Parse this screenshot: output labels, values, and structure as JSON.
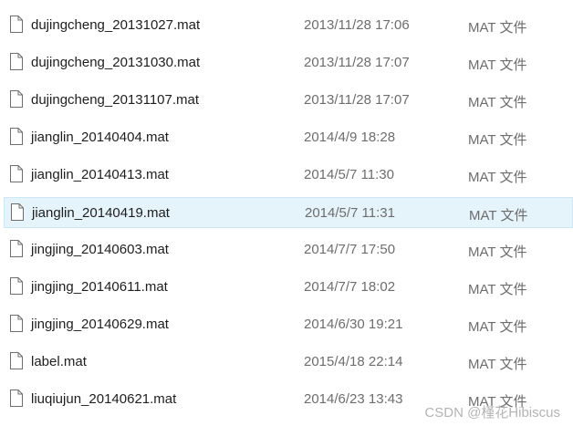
{
  "files": [
    {
      "name": "dujingcheng_20131027.mat",
      "date": "2013/11/28 17:06",
      "type": "MAT 文件",
      "selected": false
    },
    {
      "name": "dujingcheng_20131030.mat",
      "date": "2013/11/28 17:07",
      "type": "MAT 文件",
      "selected": false
    },
    {
      "name": "dujingcheng_20131107.mat",
      "date": "2013/11/28 17:07",
      "type": "MAT 文件",
      "selected": false
    },
    {
      "name": "jianglin_20140404.mat",
      "date": "2014/4/9 18:28",
      "type": "MAT 文件",
      "selected": false
    },
    {
      "name": "jianglin_20140413.mat",
      "date": "2014/5/7 11:30",
      "type": "MAT 文件",
      "selected": false
    },
    {
      "name": "jianglin_20140419.mat",
      "date": "2014/5/7 11:31",
      "type": "MAT 文件",
      "selected": true
    },
    {
      "name": "jingjing_20140603.mat",
      "date": "2014/7/7 17:50",
      "type": "MAT 文件",
      "selected": false
    },
    {
      "name": "jingjing_20140611.mat",
      "date": "2014/7/7 18:02",
      "type": "MAT 文件",
      "selected": false
    },
    {
      "name": "jingjing_20140629.mat",
      "date": "2014/6/30 19:21",
      "type": "MAT 文件",
      "selected": false
    },
    {
      "name": "label.mat",
      "date": "2015/4/18 22:14",
      "type": "MAT 文件",
      "selected": false
    },
    {
      "name": "liuqiujun_20140621.mat",
      "date": "2014/6/23 13:43",
      "type": "MAT 文件",
      "selected": false
    }
  ],
  "icon": "file-icon",
  "colors": {
    "selected_background": "#e5f3fb",
    "selected_border": "#cce8f6",
    "name_text": "#1e1e1e",
    "meta_text": "#6d6d6d"
  },
  "watermark": "CSDN @槿花Hibiscus"
}
